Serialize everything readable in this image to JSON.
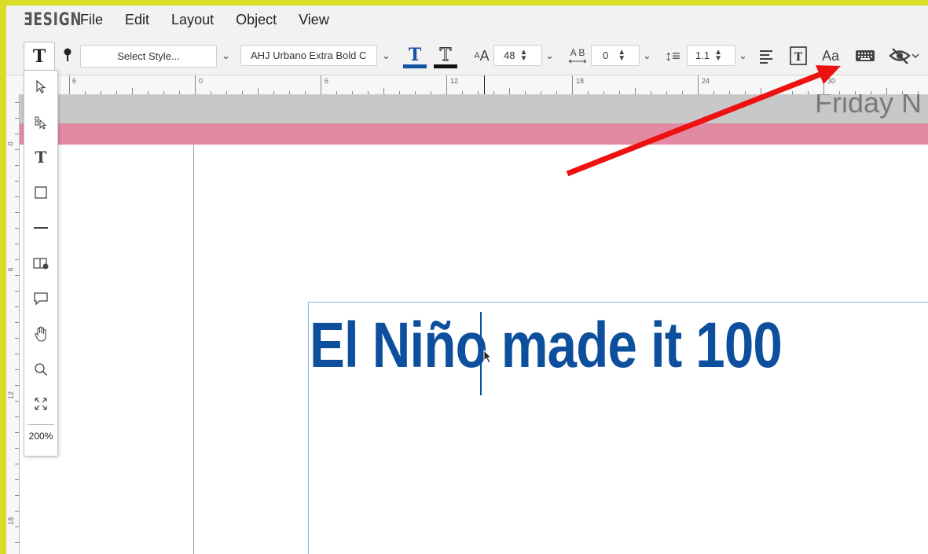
{
  "app": {
    "logo_text": "ƎESIGN"
  },
  "menu": [
    "File",
    "Edit",
    "Layout",
    "Object",
    "View"
  ],
  "toolbar": {
    "style_placeholder": "Select Style...",
    "font_name": "AHJ Urbano Extra Bold C",
    "font_size": "48",
    "tracking": "0",
    "line_spacing": "1.1",
    "fill_color": "#1552a3",
    "stroke_color": "#111111"
  },
  "ruler": {
    "h_labels": [
      "6",
      "0",
      "6",
      "12",
      "18",
      "24",
      "30"
    ],
    "v_labels": [
      "0",
      "6",
      "12",
      "18"
    ]
  },
  "tools": [
    "select-arrow-icon",
    "direct-select-icon",
    "text-tool-icon",
    "rectangle-icon",
    "line-icon",
    "book-icon",
    "comment-icon",
    "hand-icon",
    "zoom-icon",
    "fit-icon"
  ],
  "zoom_level": "200%",
  "canvas": {
    "header_text": "Friday N",
    "headline": "El Niño made it 100",
    "headline_color": "#0d4f9c",
    "band_pink": "#e38aa3",
    "band_gray": "#c8c8c8"
  },
  "annotation": {
    "arrow_color": "#ee1111"
  }
}
